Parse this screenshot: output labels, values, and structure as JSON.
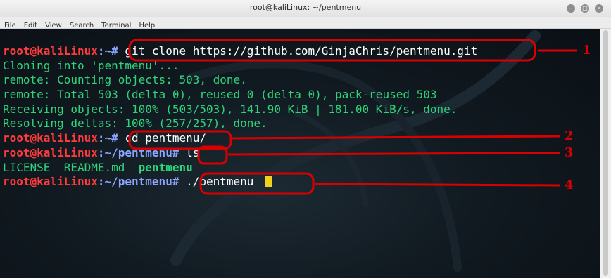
{
  "window": {
    "title": "root@kaliLinux: ~/pentmenu"
  },
  "menu": [
    "File",
    "Edit",
    "View",
    "Search",
    "Terminal",
    "Help"
  ],
  "terminal": {
    "lines": [
      {
        "type": "prompt",
        "user": "root@kaliLinux",
        "path": ":~# ",
        "cmd": "git clone https://github.com/GinjaChris/pentmenu.git"
      },
      {
        "type": "output",
        "text": "Cloning into 'pentmenu'..."
      },
      {
        "type": "output",
        "text": "remote: Counting objects: 503, done."
      },
      {
        "type": "output",
        "text": "remote: Total 503 (delta 0), reused 0 (delta 0), pack-reused 503"
      },
      {
        "type": "output",
        "text": "Receiving objects: 100% (503/503), 141.90 KiB | 181.00 KiB/s, done."
      },
      {
        "type": "output",
        "text": "Resolving deltas: 100% (257/257), done."
      },
      {
        "type": "prompt",
        "user": "root@kaliLinux",
        "path": ":~# ",
        "cmd": "cd pentmenu/"
      },
      {
        "type": "prompt",
        "user": "root@kaliLinux",
        "path": ":~/pentmenu# ",
        "cmd": "ls"
      },
      {
        "type": "listing",
        "files": [
          "LICENSE",
          "README.md"
        ],
        "dir": "pentmenu"
      },
      {
        "type": "prompt",
        "user": "root@kaliLinux",
        "path": ":~/pentmenu# ",
        "cmd": "./pentmenu "
      }
    ]
  },
  "annotations": {
    "labels": [
      "1",
      "2",
      "3",
      "4"
    ],
    "color": "#d80000"
  },
  "colors": {
    "terminal_bg": "#111a21",
    "prompt_user": "#ff3b3b",
    "prompt_path": "#8aa6ff",
    "output": "#2fd37a",
    "cursor": "#f1d11e"
  }
}
